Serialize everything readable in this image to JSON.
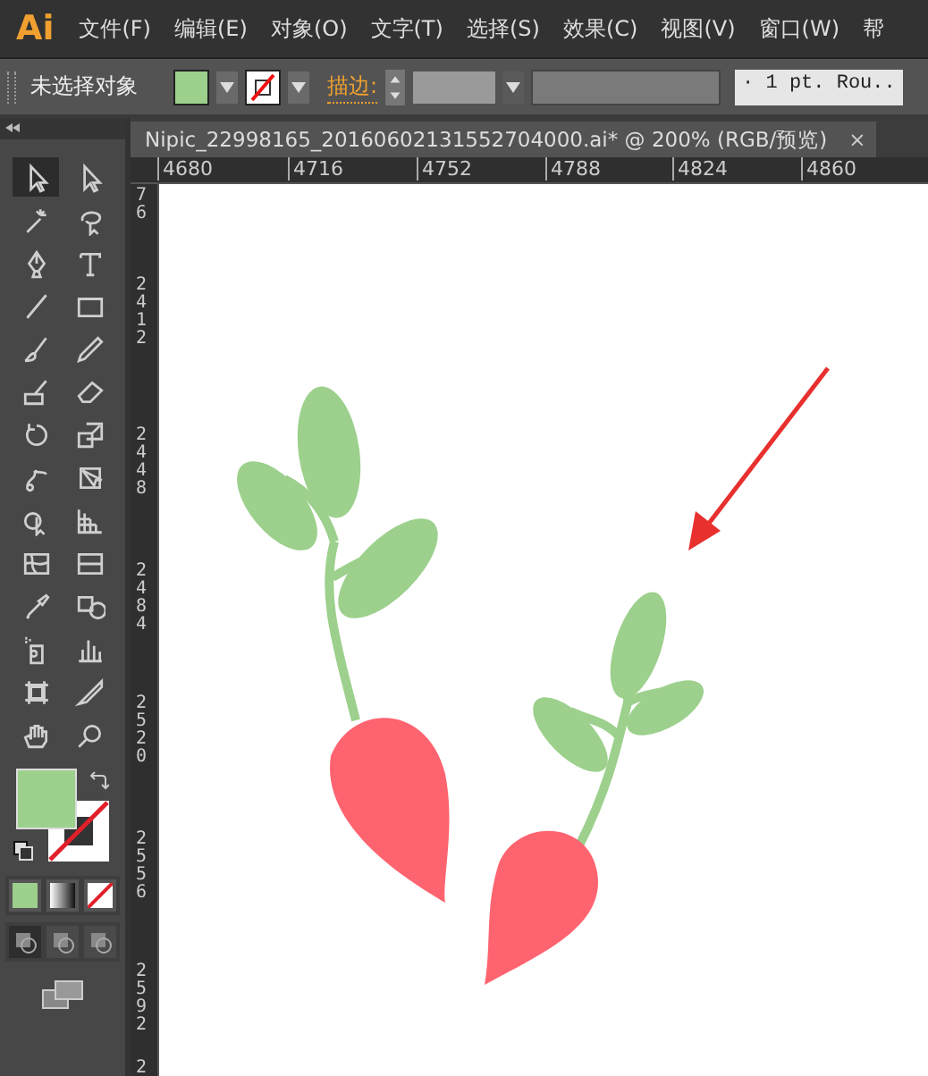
{
  "app": {
    "logo": "Ai"
  },
  "menu": [
    "文件(F)",
    "编辑(E)",
    "对象(O)",
    "文字(T)",
    "选择(S)",
    "效果(C)",
    "视图(V)",
    "窗口(W)",
    "帮"
  ],
  "control_bar": {
    "selection": "未选择对象",
    "stroke_label": "描边:",
    "stroke_profile": "· 1 pt. Rou.."
  },
  "document_tab": {
    "title": "Nipic_22998165_20160602131552704000.ai*  @  200%  (RGB/预览)",
    "close": "×"
  },
  "ruler_h": [
    "4680",
    "4716",
    "4752",
    "4788",
    "4824",
    "4860"
  ],
  "ruler_v": [
    "76",
    "2412",
    "2448",
    "2484",
    "2520",
    "2556",
    "2592",
    "2"
  ],
  "tools": [
    {
      "selected": true
    },
    {
      "selected": false
    },
    {
      "selected": false
    },
    {
      "selected": false
    },
    {
      "selected": false
    },
    {
      "selected": false
    },
    {
      "selected": false
    },
    {
      "selected": false
    },
    {
      "selected": false
    },
    {
      "selected": false
    },
    {
      "selected": false
    },
    {
      "selected": false
    },
    {
      "selected": false
    },
    {
      "selected": false
    },
    {
      "selected": false
    },
    {
      "selected": false
    },
    {
      "selected": false
    },
    {
      "selected": false
    },
    {
      "selected": false
    },
    {
      "selected": false
    },
    {
      "selected": false
    },
    {
      "selected": false
    },
    {
      "selected": false
    },
    {
      "selected": false
    },
    {
      "selected": false
    },
    {
      "selected": false
    },
    {
      "selected": false
    },
    {
      "selected": false
    }
  ],
  "draw_modes": [
    {
      "selected": true
    },
    {
      "selected": false
    },
    {
      "selected": false
    }
  ]
}
